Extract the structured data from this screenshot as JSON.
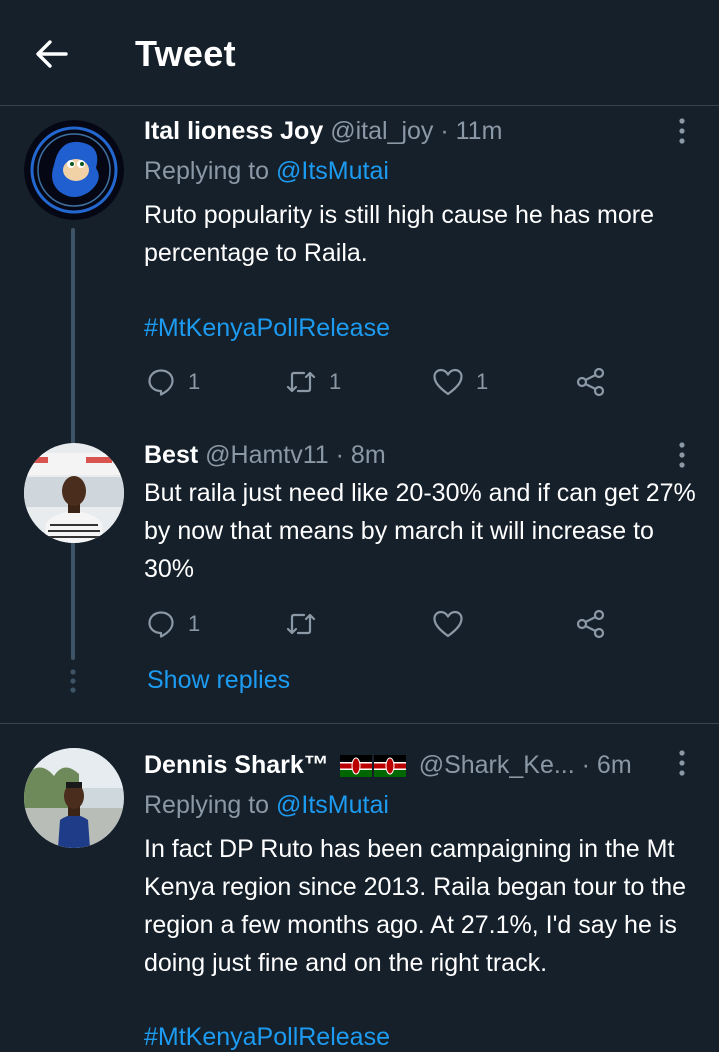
{
  "header": {
    "title": "Tweet"
  },
  "tweets": [
    {
      "display_name": "Ital lioness Joy",
      "handle": "@ital_joy",
      "time": "· 11m",
      "replying_prefix": "Replying to ",
      "replying_to": "@ItsMutai",
      "text": "Ruto popularity is still high cause he has more percentage to Raila.",
      "hashtag": "#MtKenyaPollRelease",
      "reply_count": "1",
      "retweet_count": "1",
      "like_count": "1"
    },
    {
      "display_name": "Best",
      "handle": "@Hamtv11",
      "time": "· 8m",
      "text": "But raila just need like 20-30% and if can get 27% by now that means by march it will increase to 30%",
      "reply_count": "1",
      "retweet_count": "",
      "like_count": ""
    },
    {
      "display_name": "Dennis Shark™",
      "handle": "@Shark_Ke...",
      "time": "· 6m",
      "replying_prefix": "Replying to ",
      "replying_to": "@ItsMutai",
      "text": "In fact DP Ruto has been campaigning in the Mt Kenya region since 2013. Raila began tour to the region a few months ago. At 27.1%, I'd say he is doing just fine and on the right track.",
      "hashtag": "#MtKenyaPollRelease"
    }
  ],
  "thread": {
    "show_replies": "Show replies"
  },
  "colors": {
    "background": "#15202b",
    "accent": "#1d9bf0",
    "secondary_text": "#8b98a5",
    "divider": "#38444d"
  },
  "icons": [
    "back-arrow-icon",
    "more-icon",
    "reply-icon",
    "retweet-icon",
    "like-icon",
    "share-icon",
    "kenya-flag-icon"
  ]
}
